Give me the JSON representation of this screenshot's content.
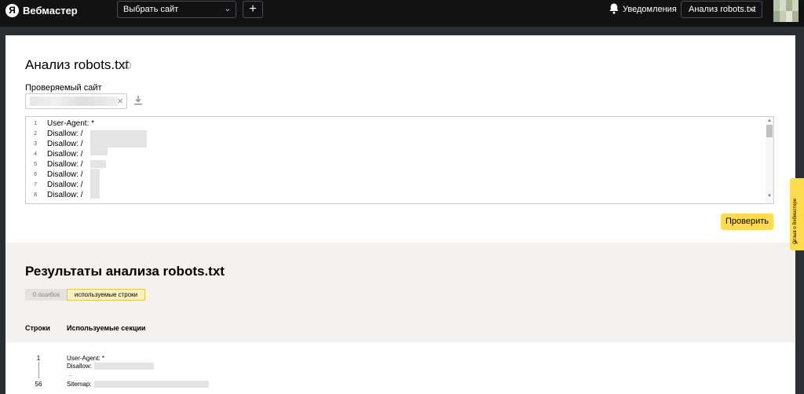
{
  "header": {
    "logo_letter": "Я",
    "app_name": "Вебмастер",
    "site_select_label": "Выбрать сайт",
    "add_label": "+",
    "notifications_label": "Уведомления",
    "tool_select_label": "Анализ robots.txt"
  },
  "main": {
    "title": "Анализ robots.txt",
    "info_icon": "i",
    "site_field_label": "Проверяемый сайт",
    "clear_symbol": "×",
    "editor_lines": [
      {
        "num": "1",
        "text": "User-Agent: *"
      },
      {
        "num": "2",
        "text": "Disallow: /"
      },
      {
        "num": "3",
        "text": "Disallow: /"
      },
      {
        "num": "4",
        "text": "Disallow: /"
      },
      {
        "num": "5",
        "text": "Disallow: /"
      },
      {
        "num": "6",
        "text": "Disallow: /"
      },
      {
        "num": "7",
        "text": "Disallow: /"
      },
      {
        "num": "8",
        "text": "Disallow: /"
      }
    ],
    "check_button": "Проверить"
  },
  "results": {
    "title": "Результаты анализа robots.txt",
    "tab_errors": "0 ошибок",
    "tab_used": "используемые строки",
    "col_lines": "Строки",
    "col_sections": "Используемые секции",
    "row_start": "1",
    "row_end": "56",
    "user_agent": "User-Agent: *",
    "disallow": "Disallow:",
    "ellipsis": "...",
    "sitemap": "Sitemap:"
  },
  "feedback": {
    "label": "Отзыв о Вебмастере"
  },
  "colors": {
    "accent": "#ffdb4d",
    "topbar": "#121212",
    "results_bg": "#f3f2ef"
  }
}
